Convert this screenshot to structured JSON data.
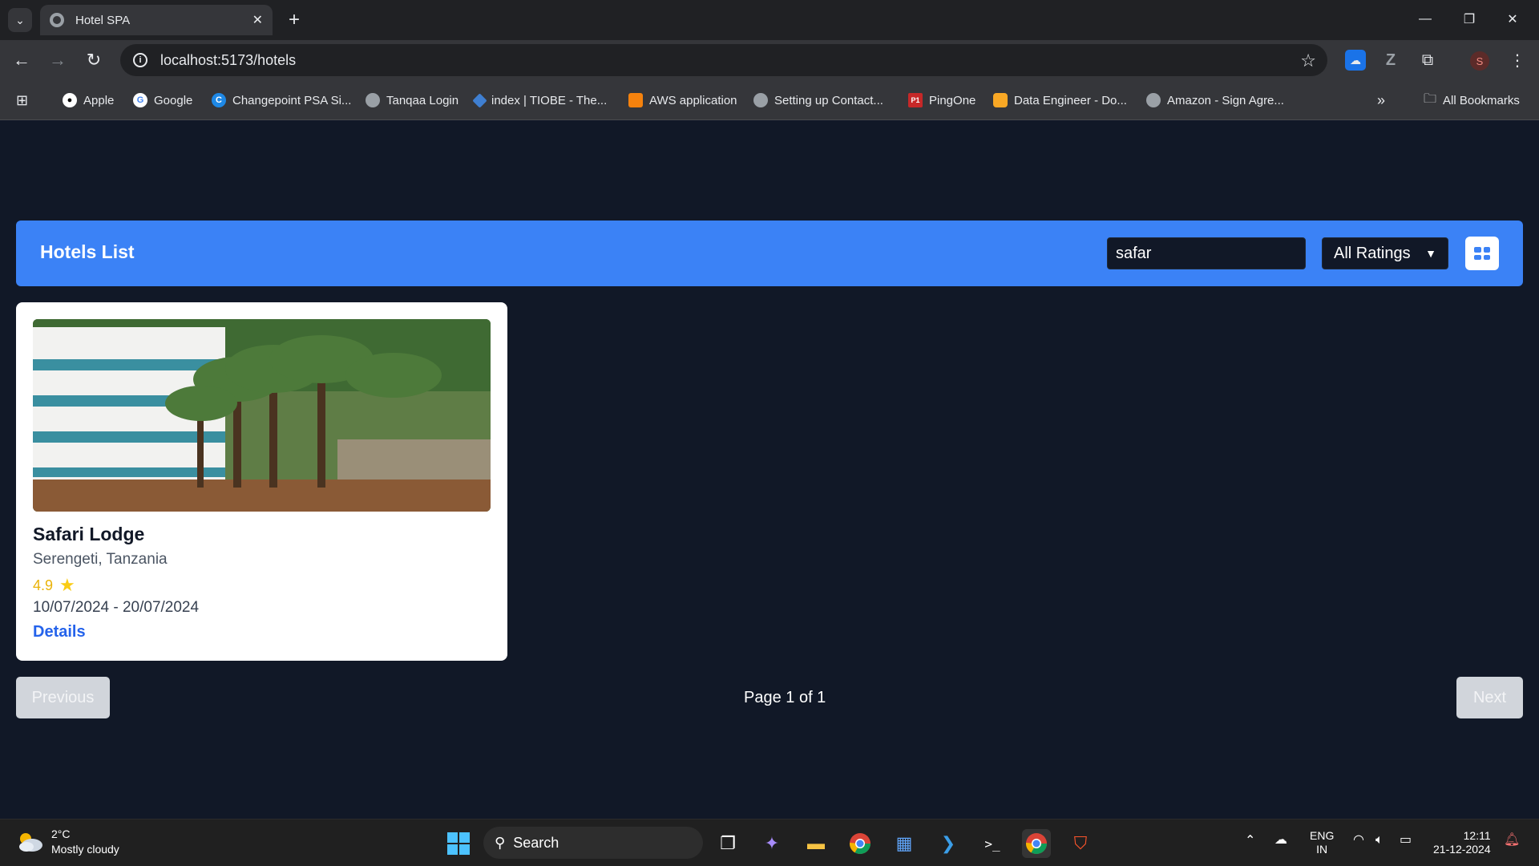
{
  "browser": {
    "tab_title": "Hotel SPA",
    "url": "localhost:5173/hotels",
    "profile_initial": "S",
    "bookmarks": [
      {
        "label": "Apple"
      },
      {
        "label": "Google"
      },
      {
        "label": "Changepoint PSA Si..."
      },
      {
        "label": "Tanqaa Login"
      },
      {
        "label": "index | TIOBE - The..."
      },
      {
        "label": "AWS application"
      },
      {
        "label": "Setting up Contact..."
      },
      {
        "label": "PingOne"
      },
      {
        "label": "Data Engineer - Do..."
      },
      {
        "label": "Amazon - Sign Agre..."
      }
    ],
    "all_bookmarks": "All Bookmarks"
  },
  "header": {
    "title": "Hotels List",
    "search_value": "safar",
    "rating_filter": "All Ratings"
  },
  "hotels": [
    {
      "name": "Safari Lodge",
      "location": "Serengeti, Tanzania",
      "rating": "4.9",
      "dates": "10/07/2024 - 20/07/2024",
      "details_label": "Details"
    }
  ],
  "pagination": {
    "previous_label": "Previous",
    "next_label": "Next",
    "page_info": "Page 1 of 1"
  },
  "taskbar": {
    "weather_temp": "2°C",
    "weather_desc": "Mostly cloudy",
    "search_label": "Search",
    "lang": "ENG",
    "region": "IN",
    "time": "12:11",
    "date": "21-12-2024"
  }
}
